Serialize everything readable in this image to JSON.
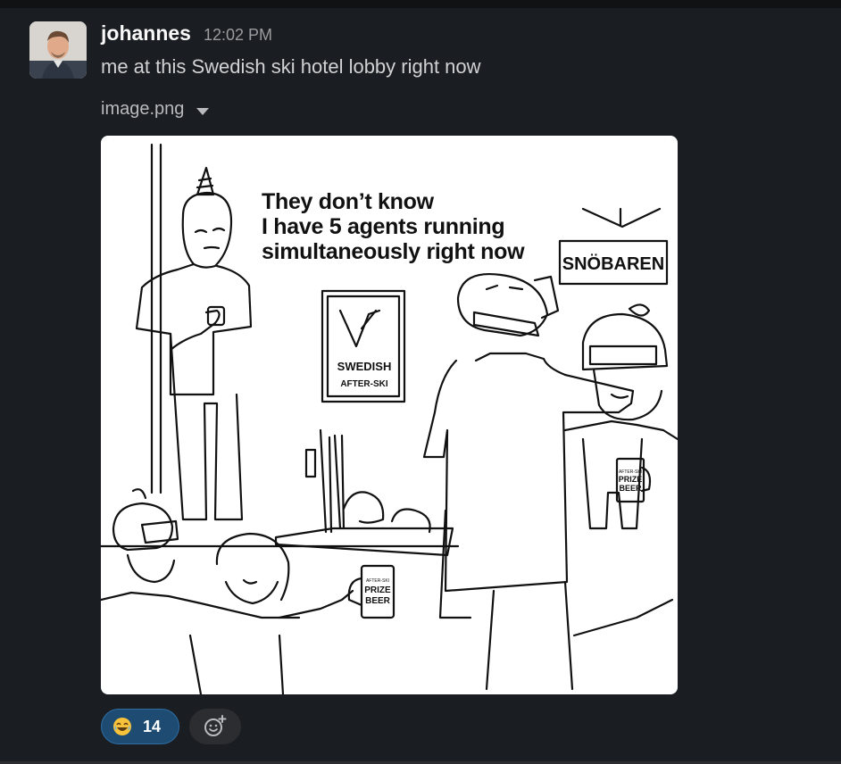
{
  "message": {
    "sender": "johannes",
    "time": "12:02 PM",
    "text": "me at this Swedish ski hotel lobby right now",
    "attachment": {
      "file_name": "image.png",
      "meme": {
        "caption_line1": "They don’t know",
        "caption_line2": "I have 5 agents running",
        "caption_line3": "simultaneously right now",
        "sign_text": "SNÖBAREN",
        "poster_line1": "SWEDISH",
        "poster_line2": "AFTER-SKI",
        "mug_text_a": "AFTER-SKI",
        "mug_text_b": "PRIZE",
        "mug_text_c": "BEER"
      }
    }
  },
  "reactions": [
    {
      "emoji": "joy-emoji",
      "count": "14"
    }
  ],
  "colors": {
    "background": "#1a1d21",
    "reaction_bg": "#1d4b72",
    "reaction_border": "#2f6da3"
  }
}
